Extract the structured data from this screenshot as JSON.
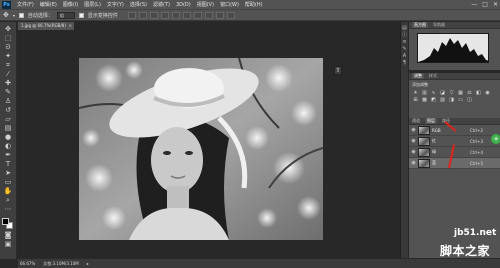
{
  "app": {
    "logo": "Ps"
  },
  "menubar": {
    "items": [
      "文件(F)",
      "编辑(E)",
      "图像(I)",
      "图层(L)",
      "文字(Y)",
      "选择(S)",
      "滤镜(T)",
      "3D(D)",
      "视图(V)",
      "窗口(W)",
      "帮助(H)"
    ],
    "window_buttons": [
      "—",
      "□",
      "✕"
    ]
  },
  "options": {
    "auto_select_label": "自动选择：",
    "auto_select_value": "组",
    "transform_label": "显示变换控件"
  },
  "document": {
    "tab_title": "1.jpg @ 66.7%(RGB/8)",
    "tab_close": "×"
  },
  "status": {
    "zoom": "66.67%",
    "doc_size": "文档:3.10M/3.10M"
  },
  "histogram": {
    "tabs": [
      "直方图",
      "导航器"
    ]
  },
  "adjustments": {
    "tabs": [
      "调整",
      "样式"
    ],
    "label": "添加调整"
  },
  "layers": {
    "tabs": [
      "通道",
      "图层",
      "路径"
    ],
    "active_tab": "图层",
    "rows": [
      {
        "name": "RGB",
        "shortcut": "Ctrl+2",
        "selected": false
      },
      {
        "name": "红",
        "shortcut": "Ctrl+3",
        "selected": false
      },
      {
        "name": "绿",
        "shortcut": "Ctrl+4",
        "selected": false
      },
      {
        "name": "蓝",
        "shortcut": "Ctrl+5",
        "selected": true
      }
    ]
  },
  "watermark": {
    "site": "jb51.net",
    "name": "脚本之家"
  },
  "colors": {
    "annotation_red": "#e0241c",
    "accent_green": "#3fb14c",
    "ps_blue": "#4fb3ff"
  }
}
